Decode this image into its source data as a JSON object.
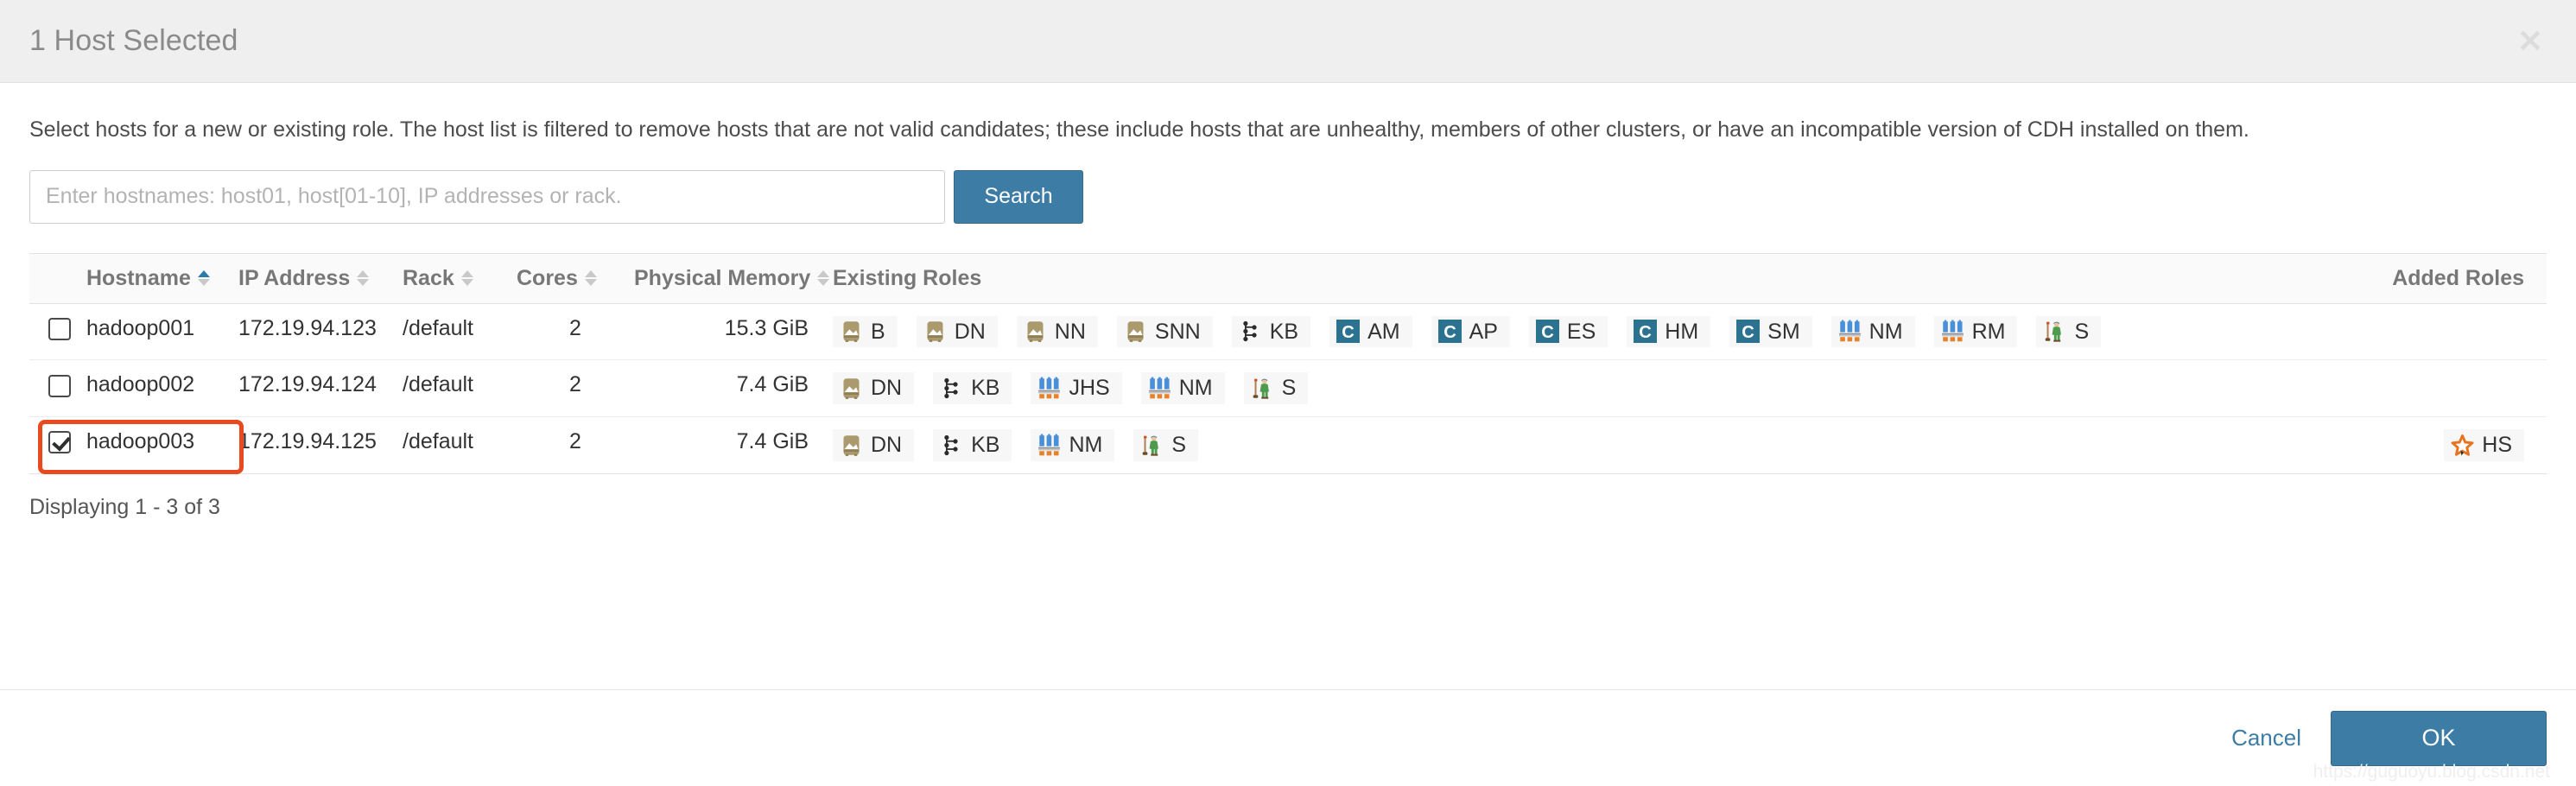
{
  "header": {
    "title": "1 Host Selected",
    "close_icon": "close-icon"
  },
  "body": {
    "description": "Select hosts for a new or existing role. The host list is filtered to remove hosts that are not valid candidates; these include hosts that are unhealthy, members of other clusters, or have an incompatible version of CDH installed on them.",
    "displaying": "Displaying 1 - 3 of 3"
  },
  "search": {
    "placeholder": "Enter hostnames: host01, host[01-10], IP addresses or rack.",
    "value": "",
    "button_label": "Search"
  },
  "table": {
    "columns": [
      {
        "label": "Hostname",
        "sortable": true,
        "sort_state": "asc"
      },
      {
        "label": "IP Address",
        "sortable": true,
        "sort_state": "none"
      },
      {
        "label": "Rack",
        "sortable": true,
        "sort_state": "none"
      },
      {
        "label": "Cores",
        "sortable": true,
        "sort_state": "none"
      },
      {
        "label": "Physical Memory",
        "sortable": true,
        "sort_state": "none"
      },
      {
        "label": "Existing Roles",
        "sortable": false,
        "sort_state": "none"
      },
      {
        "label": "Added Roles",
        "sortable": false,
        "sort_state": "none"
      }
    ],
    "rows": [
      {
        "selected": false,
        "hostname": "hadoop001",
        "ip": "172.19.94.123",
        "rack": "/default",
        "cores": "2",
        "memory": "15.3 GiB",
        "existing_roles": [
          {
            "label": "B",
            "icon": "hdfs-icon"
          },
          {
            "label": "DN",
            "icon": "hdfs-icon"
          },
          {
            "label": "NN",
            "icon": "hdfs-icon"
          },
          {
            "label": "SNN",
            "icon": "hdfs-icon"
          },
          {
            "label": "KB",
            "icon": "kerberos-icon"
          },
          {
            "label": "AM",
            "icon": "cloudera-icon"
          },
          {
            "label": "AP",
            "icon": "cloudera-icon"
          },
          {
            "label": "ES",
            "icon": "cloudera-icon"
          },
          {
            "label": "HM",
            "icon": "cloudera-icon"
          },
          {
            "label": "SM",
            "icon": "cloudera-icon"
          },
          {
            "label": "NM",
            "icon": "yarn-icon"
          },
          {
            "label": "RM",
            "icon": "yarn-icon"
          },
          {
            "label": "S",
            "icon": "zookeeper-icon"
          }
        ],
        "added_roles": []
      },
      {
        "selected": false,
        "hostname": "hadoop002",
        "ip": "172.19.94.124",
        "rack": "/default",
        "cores": "2",
        "memory": "7.4 GiB",
        "existing_roles": [
          {
            "label": "DN",
            "icon": "hdfs-icon"
          },
          {
            "label": "KB",
            "icon": "kerberos-icon"
          },
          {
            "label": "JHS",
            "icon": "yarn-icon"
          },
          {
            "label": "NM",
            "icon": "yarn-icon"
          },
          {
            "label": "S",
            "icon": "zookeeper-icon"
          }
        ],
        "added_roles": []
      },
      {
        "selected": true,
        "highlighted": true,
        "hostname": "hadoop003",
        "ip": "172.19.94.125",
        "rack": "/default",
        "cores": "2",
        "memory": "7.4 GiB",
        "existing_roles": [
          {
            "label": "DN",
            "icon": "hdfs-icon"
          },
          {
            "label": "KB",
            "icon": "kerberos-icon"
          },
          {
            "label": "NM",
            "icon": "yarn-icon"
          },
          {
            "label": "S",
            "icon": "zookeeper-icon"
          }
        ],
        "added_roles": [
          {
            "label": "HS",
            "icon": "star-icon"
          }
        ]
      }
    ]
  },
  "footer": {
    "cancel_label": "Cancel",
    "ok_label": "OK",
    "watermark": "https://guguoyu.blog.csdn.net"
  },
  "colors": {
    "accent_blue": "#3d7ca5",
    "highlight_red": "#e8491f",
    "cloudera_teal": "#2b7190",
    "hdfs_tan": "#ab9a6d",
    "yarn_blue": "#4a90d9",
    "yarn_orange": "#e8822a",
    "zookeeper_green": "#4e9a4e",
    "star_orange": "#e8731f"
  }
}
